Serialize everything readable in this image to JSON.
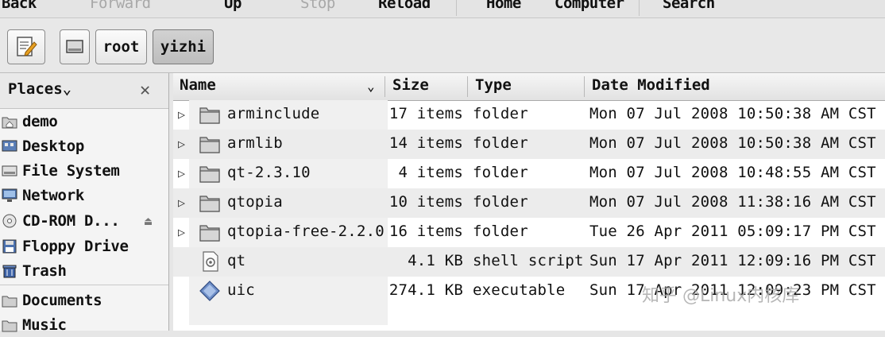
{
  "toolbar": {
    "back": "Back",
    "forward": "Forward",
    "up": "Up",
    "stop": "Stop",
    "reload": "Reload",
    "home": "Home",
    "computer": "Computer",
    "search": "Search"
  },
  "location_bar": {
    "buttons": [
      "root",
      "yizhi"
    ]
  },
  "sidebar": {
    "title": "Places",
    "items": [
      {
        "label": "demo",
        "icon": "home-folder-icon"
      },
      {
        "label": "Desktop",
        "icon": "desktop-icon"
      },
      {
        "label": "File System",
        "icon": "drive-icon"
      },
      {
        "label": "Network",
        "icon": "network-icon"
      },
      {
        "label": "CD-ROM D...",
        "icon": "cdrom-icon"
      },
      {
        "label": "Floppy Drive",
        "icon": "floppy-icon"
      },
      {
        "label": "Trash",
        "icon": "trash-icon"
      },
      {
        "label": "Documents",
        "icon": "folder-icon"
      },
      {
        "label": "Music",
        "icon": "folder-icon"
      }
    ]
  },
  "columns": {
    "name": "Name",
    "size": "Size",
    "type": "Type",
    "date": "Date Modified"
  },
  "files": [
    {
      "name": "arminclude",
      "size": "17 items",
      "type": "folder",
      "date": "Mon 07 Jul 2008 10:50:38 AM CST",
      "kind": "folder"
    },
    {
      "name": "armlib",
      "size": "14 items",
      "type": "folder",
      "date": "Mon 07 Jul 2008 10:50:38 AM CST",
      "kind": "folder"
    },
    {
      "name": "qt-2.3.10",
      "size": "4 items",
      "type": "folder",
      "date": "Mon 07 Jul 2008 10:48:55 AM CST",
      "kind": "folder"
    },
    {
      "name": "qtopia",
      "size": "10 items",
      "type": "folder",
      "date": "Mon 07 Jul 2008 11:38:16 AM CST",
      "kind": "folder"
    },
    {
      "name": "qtopia-free-2.2.0",
      "size": "16 items",
      "type": "folder",
      "date": "Tue 26 Apr 2011 05:09:17 PM CST",
      "kind": "folder"
    },
    {
      "name": "qt",
      "size": "4.1 KB",
      "type": "shell script",
      "date": "Sun 17 Apr 2011 12:09:16 PM CST",
      "kind": "script"
    },
    {
      "name": "uic",
      "size": "274.1 KB",
      "type": "executable",
      "date": "Sun 17 Apr 2011 12:09:23 PM CST",
      "kind": "executable"
    }
  ],
  "watermark": "知乎 @Linux内核库"
}
